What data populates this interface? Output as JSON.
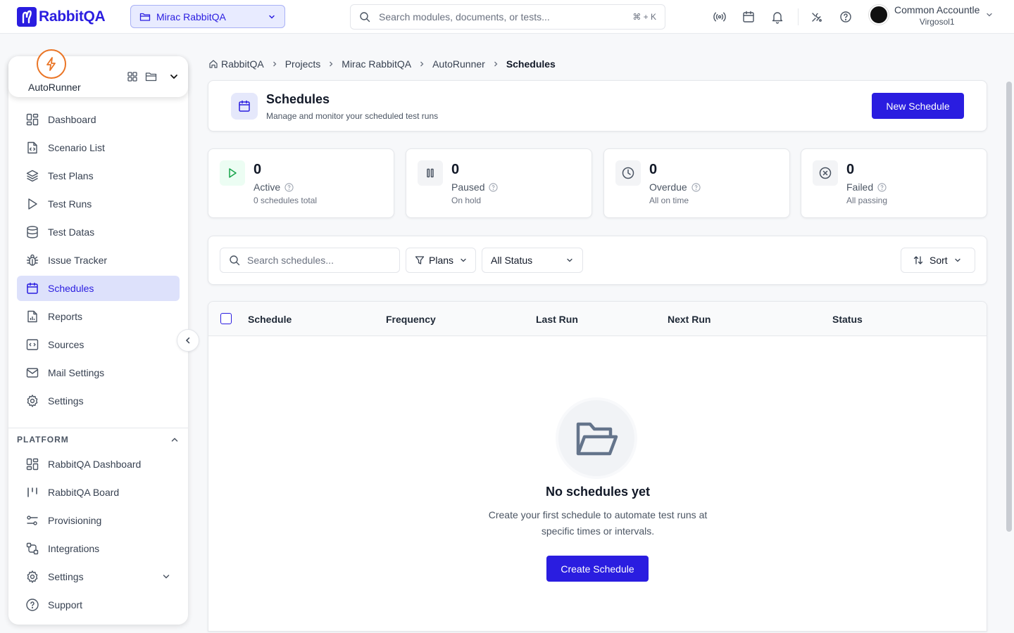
{
  "topbar": {
    "logo_text": "RabbitQA",
    "project_selector": "Mirac RabbitQA",
    "search_placeholder": "Search modules, documents, or tests...",
    "search_shortcut": "⌘ + K",
    "user_name": "Common Accountle",
    "user_org": "Virgosol1"
  },
  "sidebar": {
    "app_name": "AutoRunner",
    "items": [
      {
        "label": "Dashboard",
        "icon": "dashboard-icon"
      },
      {
        "label": "Scenario List",
        "icon": "file-code-icon"
      },
      {
        "label": "Test Plans",
        "icon": "layers-icon"
      },
      {
        "label": "Test Runs",
        "icon": "play-icon"
      },
      {
        "label": "Test Datas",
        "icon": "database-icon"
      },
      {
        "label": "Issue Tracker",
        "icon": "bug-icon"
      },
      {
        "label": "Schedules",
        "icon": "calendar-icon",
        "active": true
      },
      {
        "label": "Reports",
        "icon": "report-icon"
      },
      {
        "label": "Sources",
        "icon": "code-square-icon"
      },
      {
        "label": "Mail Settings",
        "icon": "mail-icon"
      },
      {
        "label": "Settings",
        "icon": "gear-icon"
      }
    ],
    "platform_heading": "PLATFORM",
    "platform_items": [
      {
        "label": "RabbitQA Dashboard",
        "icon": "dashboard-icon"
      },
      {
        "label": "RabbitQA Board",
        "icon": "board-icon"
      },
      {
        "label": "Provisioning",
        "icon": "sliders-icon"
      },
      {
        "label": "Integrations",
        "icon": "integrations-icon"
      },
      {
        "label": "Settings",
        "icon": "gear-icon"
      },
      {
        "label": "Support",
        "icon": "help-circle-icon"
      }
    ]
  },
  "breadcrumb": [
    "RabbitQA",
    "Projects",
    "Mirac RabbitQA",
    "AutoRunner",
    "Schedules"
  ],
  "header": {
    "title": "Schedules",
    "subtitle": "Manage and monitor your scheduled test runs",
    "new_button": "New Schedule"
  },
  "stats": [
    {
      "value": "0",
      "label": "Active",
      "sub": "0 schedules total",
      "color": "#16a34a"
    },
    {
      "value": "0",
      "label": "Paused",
      "sub": "On hold",
      "color": "#4b5563"
    },
    {
      "value": "0",
      "label": "Overdue",
      "sub": "All on time",
      "color": "#4b5563"
    },
    {
      "value": "0",
      "label": "Failed",
      "sub": "All passing",
      "color": "#4b5563"
    }
  ],
  "filters": {
    "search_placeholder": "Search schedules...",
    "plans": "Plans",
    "status": "All Status",
    "sort": "Sort"
  },
  "table": {
    "columns": [
      "Schedule",
      "Frequency",
      "Last Run",
      "Next Run",
      "Status"
    ]
  },
  "empty": {
    "title": "No schedules yet",
    "line1": "Create your first schedule to automate test runs at",
    "line2": "specific times or intervals.",
    "button": "Create Schedule"
  },
  "colors": {
    "accent": "#2a1de0",
    "app_badge": "#ea7526"
  }
}
